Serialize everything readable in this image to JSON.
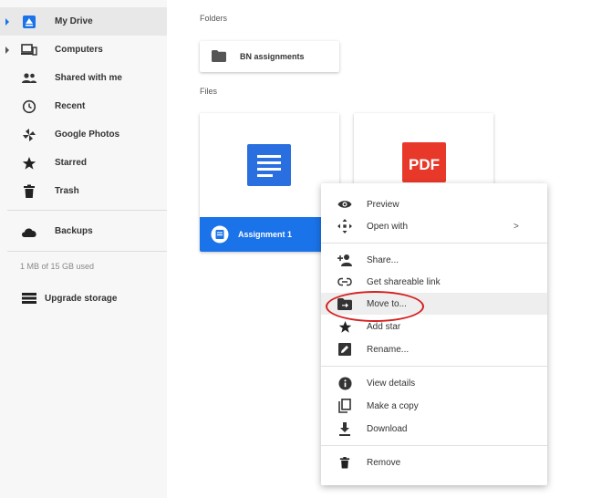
{
  "sidebar": {
    "items": [
      {
        "label": "My Drive",
        "icon": "drive-icon"
      },
      {
        "label": "Computers",
        "icon": "computers-icon"
      },
      {
        "label": "Shared with me",
        "icon": "people-icon"
      },
      {
        "label": "Recent",
        "icon": "clock-icon"
      },
      {
        "label": "Google Photos",
        "icon": "photos-icon"
      },
      {
        "label": "Starred",
        "icon": "star-icon"
      },
      {
        "label": "Trash",
        "icon": "trash-icon"
      },
      {
        "label": "Backups",
        "icon": "cloud-icon"
      }
    ],
    "storage_text": "1 MB of 15 GB used",
    "upgrade_label": "Upgrade storage"
  },
  "main": {
    "folders_label": "Folders",
    "files_label": "Files",
    "folders": [
      {
        "name": "BN assignments"
      }
    ],
    "files": [
      {
        "name": "Assignment 1",
        "type": "doc",
        "selected": true
      },
      {
        "name": "",
        "type": "pdf",
        "thumb_text": "PDF"
      }
    ]
  },
  "context_menu": {
    "items": [
      {
        "label": "Preview",
        "icon": "eye-icon"
      },
      {
        "label": "Open with",
        "icon": "open-with-icon",
        "submenu_arrow": ">"
      },
      {
        "label": "Share...",
        "icon": "person-add-icon"
      },
      {
        "label": "Get shareable link",
        "icon": "link-icon"
      },
      {
        "label": "Move to...",
        "icon": "folder-move-icon",
        "hovered": true
      },
      {
        "label": "Add star",
        "icon": "star-icon"
      },
      {
        "label": "Rename...",
        "icon": "edit-icon"
      },
      {
        "label": "View details",
        "icon": "info-icon"
      },
      {
        "label": "Make a copy",
        "icon": "copy-icon"
      },
      {
        "label": "Download",
        "icon": "download-icon"
      },
      {
        "label": "Remove",
        "icon": "trash-icon"
      }
    ]
  },
  "colors": {
    "accent": "#1a73e8",
    "pdf_red": "#e8382a",
    "annotation_red": "#d62020"
  }
}
